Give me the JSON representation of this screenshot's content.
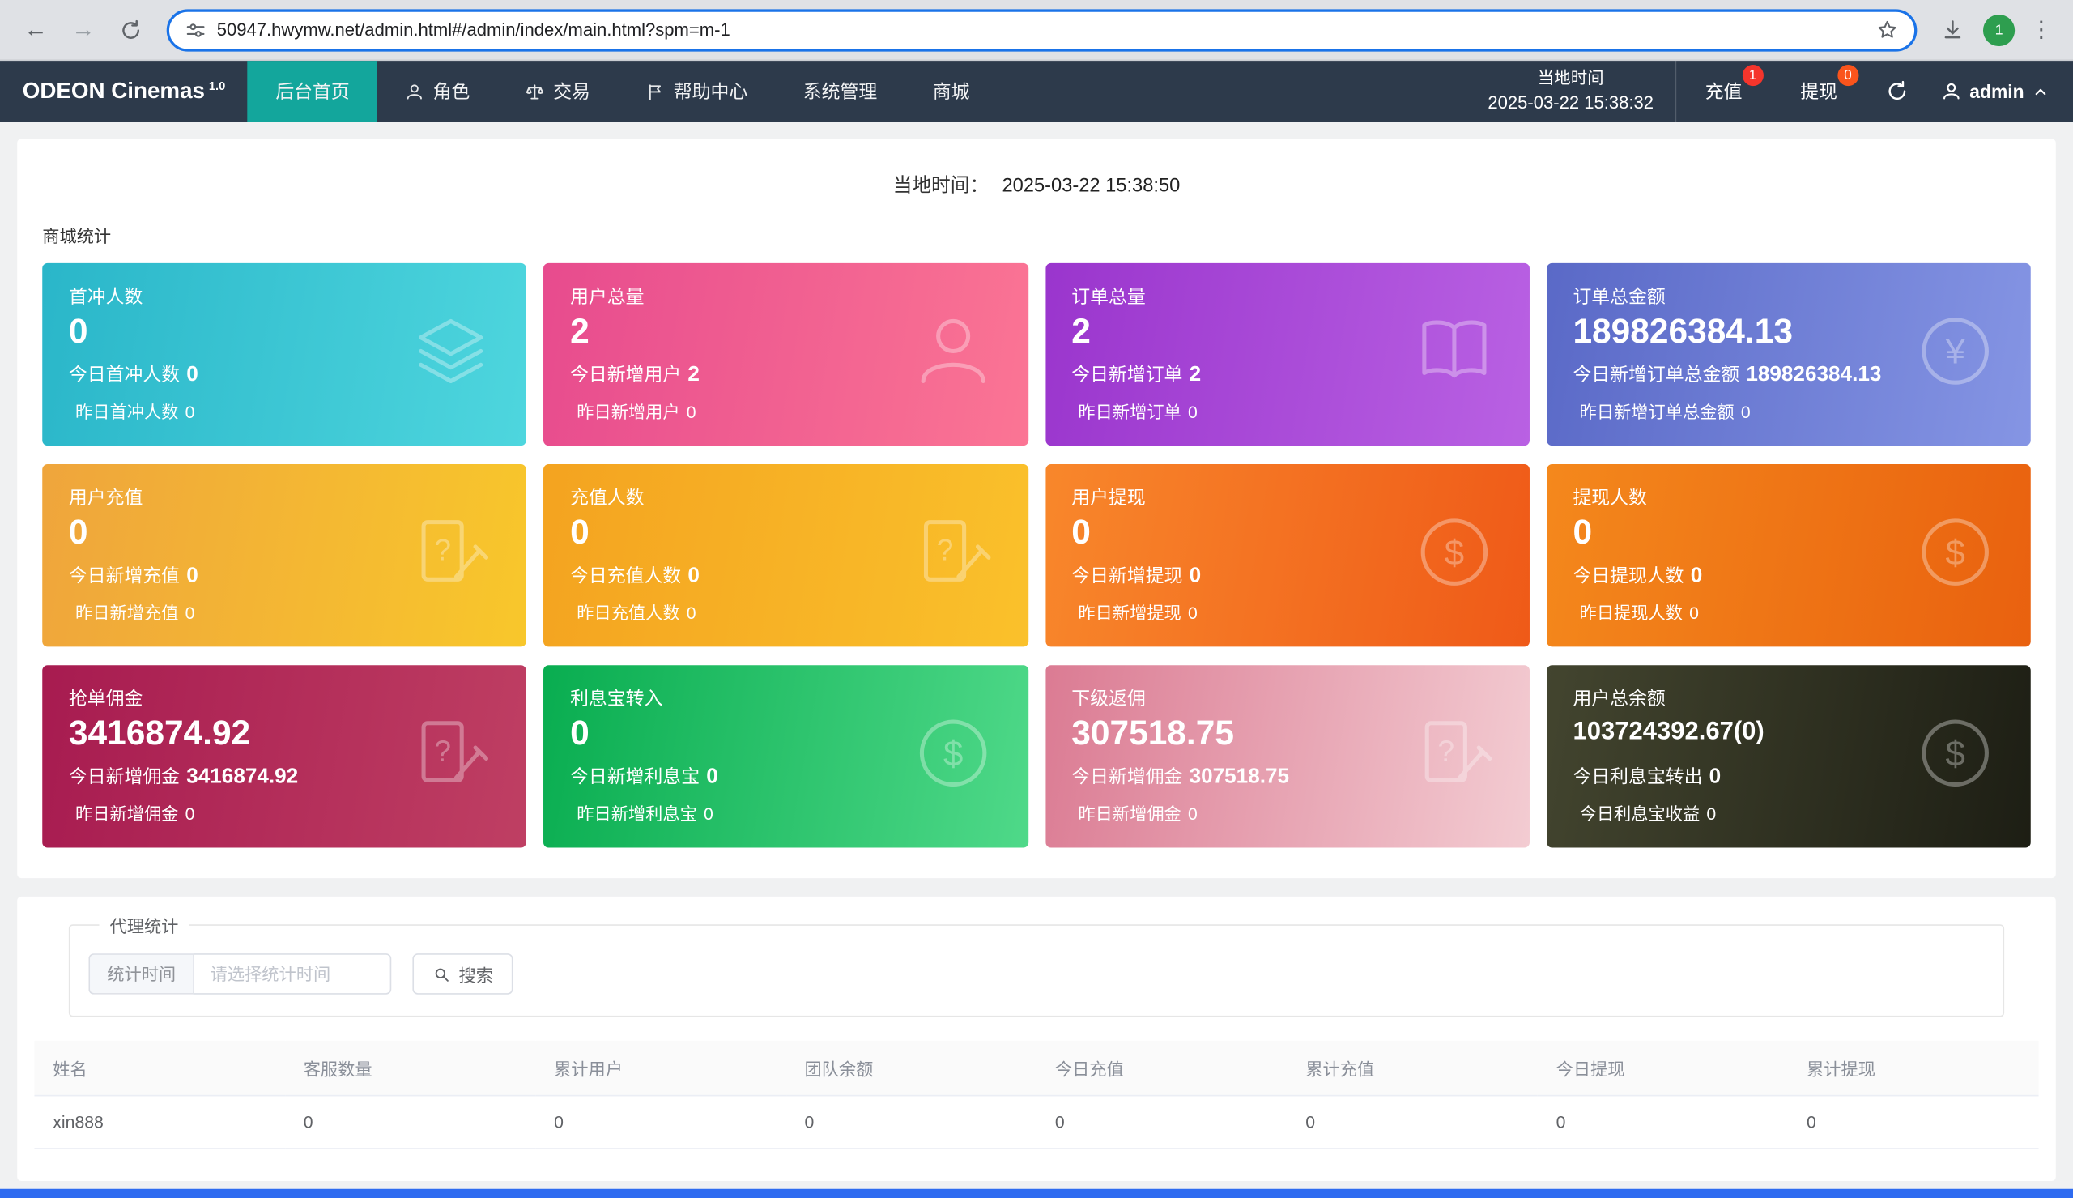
{
  "browser": {
    "url": "50947.hwymw.net/admin.html#/admin/index/main.html?spm=m-1",
    "avatar_label": "1"
  },
  "navbar": {
    "brand": "ODEON Cinemas",
    "brand_version": "1.0",
    "items": [
      {
        "label": "后台首页",
        "active": true
      },
      {
        "label": "角色",
        "icon": "person-icon"
      },
      {
        "label": "交易",
        "icon": "scale-icon"
      },
      {
        "label": "帮助中心",
        "icon": "flag-icon"
      },
      {
        "label": "系统管理"
      },
      {
        "label": "商城"
      }
    ],
    "local_time_label": "当地时间",
    "local_time_value": "2025-03-22 15:38:32",
    "recharge": {
      "label": "充值",
      "badge": "1",
      "badge_color": "#f5352c"
    },
    "withdraw": {
      "label": "提现",
      "badge": "0",
      "badge_color": "#fa541c"
    },
    "user": "admin"
  },
  "main": {
    "local_time_label": "当地时间：",
    "local_time_value": "2025-03-22 15:38:50",
    "section_title": "商城统计",
    "cards": [
      {
        "title": "首冲人数",
        "value": "0",
        "today_label": "今日首冲人数",
        "today_value": "0",
        "yesterday_label": "昨日首冲人数",
        "yesterday_value": "0",
        "icon": "layers-icon",
        "gradient": {
          "from": "#2ab6c9",
          "to": "#4ed6de"
        }
      },
      {
        "title": "用户总量",
        "value": "2",
        "today_label": "今日新增用户",
        "today_value": "2",
        "yesterday_label": "昨日新增用户",
        "yesterday_value": "0",
        "icon": "user-icon",
        "gradient": {
          "from": "#e74b8e",
          "to": "#fb7594"
        }
      },
      {
        "title": "订单总量",
        "value": "2",
        "today_label": "今日新增订单",
        "today_value": "2",
        "yesterday_label": "昨日新增订单",
        "yesterday_value": "0",
        "icon": "book-icon",
        "gradient": {
          "from": "#9a35cd",
          "to": "#b961e3"
        }
      },
      {
        "title": "订单总金额",
        "value": "189826384.13",
        "today_label": "今日新增订单总金额",
        "today_value": "189826384.13",
        "yesterday_label": "昨日新增订单总金额",
        "yesterday_value": "0",
        "icon": "yen-icon",
        "gradient": {
          "from": "#5a69c7",
          "to": "#8595e4"
        }
      },
      {
        "title": "用户充值",
        "value": "0",
        "today_label": "今日新增充值",
        "today_value": "0",
        "yesterday_label": "昨日新增充值",
        "yesterday_value": "0",
        "icon": "edit-doc-icon",
        "gradient": {
          "from": "#efa53c",
          "to": "#f8c72b"
        }
      },
      {
        "title": "充值人数",
        "value": "0",
        "today_label": "今日充值人数",
        "today_value": "0",
        "yesterday_label": "昨日充值人数",
        "yesterday_value": "0",
        "icon": "edit-doc-icon",
        "gradient": {
          "from": "#f4a320",
          "to": "#fac12b"
        }
      },
      {
        "title": "用户提现",
        "value": "0",
        "today_label": "今日新增提现",
        "today_value": "0",
        "yesterday_label": "昨日新增提现",
        "yesterday_value": "0",
        "icon": "dollar-icon",
        "gradient": {
          "from": "#f8872b",
          "to": "#ef5a18"
        }
      },
      {
        "title": "提现人数",
        "value": "0",
        "today_label": "今日提现人数",
        "today_value": "0",
        "yesterday_label": "昨日提现人数",
        "yesterday_value": "0",
        "icon": "dollar-icon",
        "gradient": {
          "from": "#f4881c",
          "to": "#e9610f"
        }
      },
      {
        "title": "抢单佣金",
        "value": "3416874.92",
        "today_label": "今日新增佣金",
        "today_value": "3416874.92",
        "yesterday_label": "昨日新增佣金",
        "yesterday_value": "0",
        "icon": "edit-doc-icon",
        "gradient": {
          "from": "#a71b50",
          "to": "#bf3f63"
        }
      },
      {
        "title": "利息宝转入",
        "value": "0",
        "today_label": "今日新增利息宝",
        "today_value": "0",
        "yesterday_label": "昨日新增利息宝",
        "yesterday_value": "0",
        "icon": "dollar-icon",
        "gradient": {
          "from": "#09ad50",
          "to": "#4fd989"
        }
      },
      {
        "title": "下级返佣",
        "value": "307518.75",
        "today_label": "今日新增佣金",
        "today_value": "307518.75",
        "yesterday_label": "昨日新增佣金",
        "yesterday_value": "0",
        "icon": "edit-doc-icon",
        "gradient": {
          "from": "#db7b93",
          "to": "#f3ccd2"
        }
      },
      {
        "title": "用户总余额",
        "value": "103724392.67(0)",
        "value_small": true,
        "today_label": "今日利息宝转出",
        "today_value": "0",
        "yesterday_label": "今日利息宝收益",
        "yesterday_value": "0",
        "icon": "dollar-icon",
        "gradient": {
          "from": "#43452f",
          "to": "#1d1e14"
        }
      }
    ],
    "agent": {
      "legend": "代理统计",
      "filter_label": "统计时间",
      "filter_placeholder": "请选择统计时间",
      "search_label": "搜索",
      "table": {
        "headers": [
          "姓名",
          "客服数量",
          "累计用户",
          "团队余额",
          "今日充值",
          "累计充值",
          "今日提现",
          "累计提现"
        ],
        "rows": [
          [
            "xin888",
            "0",
            "0",
            "0",
            "0",
            "0",
            "0",
            "0"
          ]
        ]
      }
    }
  },
  "accent": {
    "active_tab": "#13a69c",
    "bottom_bar": "#2e6bf0"
  }
}
